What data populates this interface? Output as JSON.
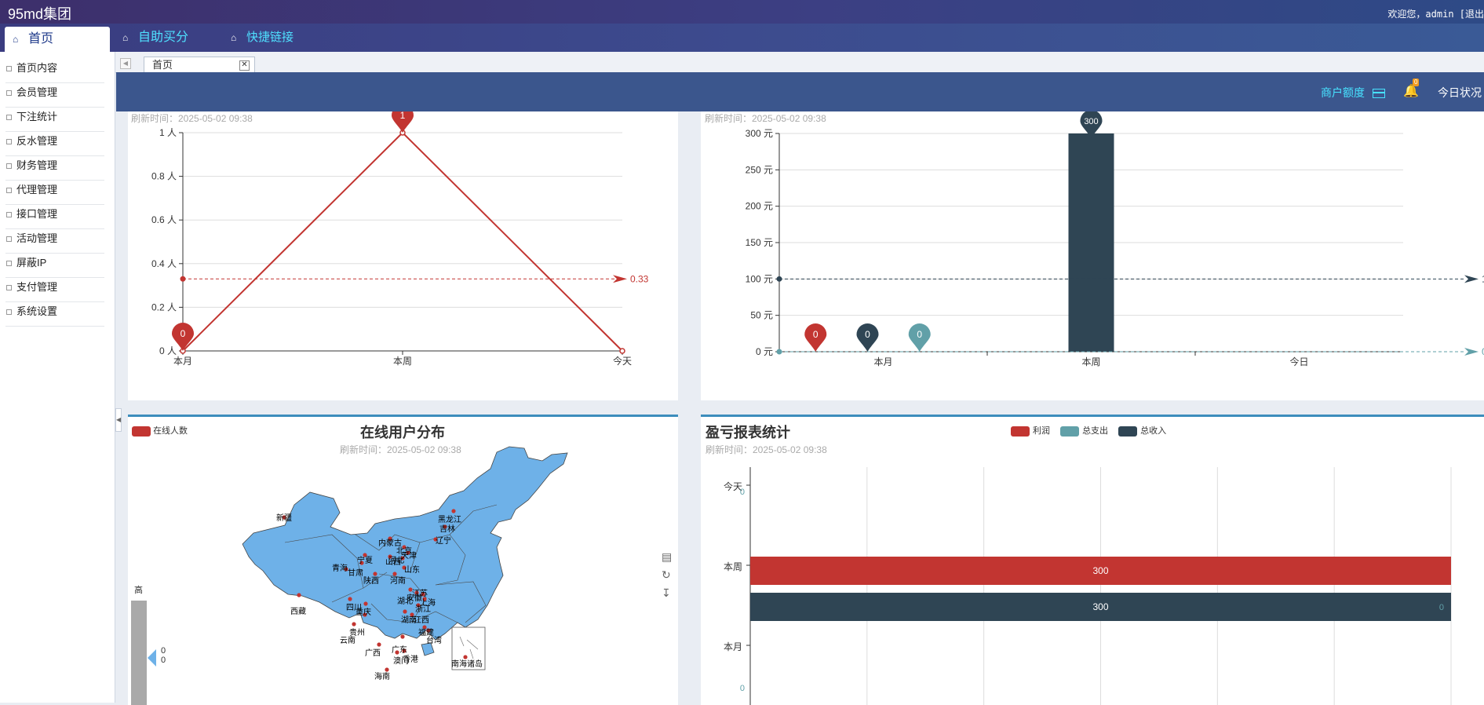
{
  "header": {
    "brand": "95md集团",
    "welcome": "欢迎您，admin [退出"
  },
  "nav": {
    "tabs": [
      {
        "label": "首页",
        "active": true
      },
      {
        "label": "自助买分"
      },
      {
        "label": "快捷链接"
      }
    ]
  },
  "sidebar": {
    "items": [
      "首页内容",
      "会员管理",
      "下注统计",
      "反水管理",
      "财务管理",
      "代理管理",
      "接口管理",
      "活动管理",
      "屏蔽IP",
      "支付管理",
      "系统设置"
    ]
  },
  "tabstrip": {
    "active_tab": "首页",
    "close": "✕"
  },
  "banner": {
    "merchant_label": "商户额度",
    "notification_count": "0",
    "today_label": "今日状况"
  },
  "colors": {
    "red": "#c23531",
    "navy": "#2f4554",
    "teal": "#61a0a8",
    "map_fill": "#6eb1e8"
  },
  "charts": {
    "online_users": {
      "refresh": "刷新时间：2025-05-02 09:38",
      "chart_data": {
        "type": "line",
        "categories": [
          "本月",
          "本周",
          "今天"
        ],
        "values": [
          0,
          1,
          0
        ],
        "yticks": [
          "0 人",
          "0.2 人",
          "0.4 人",
          "0.6 人",
          "0.8 人",
          "1 人"
        ],
        "ylim": [
          0,
          1
        ],
        "average": 0.33,
        "average_label": "0.33",
        "markers": [
          {
            "category": "本月",
            "label": "0"
          },
          {
            "category": "本周",
            "label": "1"
          }
        ]
      }
    },
    "revenue_bar": {
      "refresh": "刷新时间：2025-05-02 09:38",
      "chart_data": {
        "type": "bar",
        "categories": [
          "本月",
          "本周",
          "今日"
        ],
        "yticks": [
          "0 元",
          "50 元",
          "100 元",
          "150 元",
          "200 元",
          "250 元",
          "300 元"
        ],
        "ylim": [
          0,
          300
        ],
        "bars": [
          {
            "category": "本周",
            "value": 300,
            "label": "300"
          }
        ],
        "markers": [
          {
            "label": "0"
          },
          {
            "label": "0"
          },
          {
            "label": "0"
          }
        ],
        "markline_avg": {
          "value": 100,
          "label": "100"
        },
        "markline_zero": {
          "value": 0,
          "label": "0"
        }
      }
    },
    "map": {
      "title": "在线用户分布",
      "refresh": "刷新时间：2025-05-02 09:38",
      "legend": "在线人数",
      "visual_high": "高",
      "visual_values": [
        "0",
        "0"
      ],
      "provinces": [
        "新疆",
        "西藏",
        "青海",
        "甘肃",
        "宁夏",
        "内蒙古",
        "黑龙江",
        "吉林",
        "辽宁",
        "北京",
        "天津",
        "河北",
        "山西",
        "山东",
        "河南",
        "陕西",
        "四川",
        "重庆",
        "湖北",
        "安徽",
        "江苏",
        "上海",
        "浙江",
        "湖南",
        "江西",
        "贵州",
        "云南",
        "广西",
        "广东",
        "福建",
        "台湾",
        "香港",
        "澳门",
        "海南",
        "南海诸岛"
      ],
      "tools": [
        "data-view",
        "restore",
        "save-image"
      ]
    },
    "profit_loss": {
      "title": "盈亏报表统计",
      "refresh": "刷新时间：2025-05-02 09:38",
      "legend": [
        "利润",
        "总支出",
        "总收入"
      ],
      "chart_data": {
        "type": "bar",
        "orientation": "horizontal",
        "categories": [
          "今天",
          "本周",
          "本月"
        ],
        "series": [
          {
            "name": "利润",
            "values": [
              0,
              300,
              0
            ]
          },
          {
            "name": "总支出",
            "values": [
              0,
              0,
              0
            ]
          },
          {
            "name": "总收入",
            "values": [
              0,
              300,
              0
            ]
          }
        ],
        "value_labels": [
          "0",
          "300",
          "300",
          "0",
          "0"
        ]
      }
    }
  }
}
